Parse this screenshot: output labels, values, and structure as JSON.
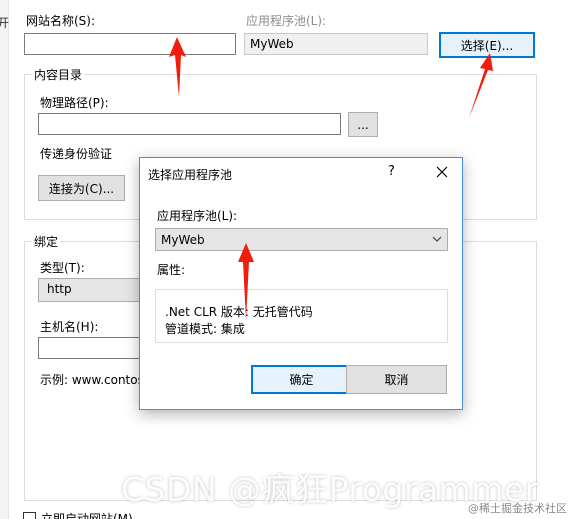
{
  "edge_text": "开",
  "site_name": {
    "label": "网站名称(S):",
    "value": ""
  },
  "app_pool": {
    "label": "应用程序池(L):",
    "value": "MyWeb",
    "select_button": "选择(E)..."
  },
  "content_dir": {
    "group_title": "内容目录",
    "physical_path_label": "物理路径(P):",
    "physical_path_value": "",
    "browse_button": "...",
    "pass_through_label": "传递身份验证",
    "connect_as_button": "连接为(C)..."
  },
  "binding": {
    "group_title": "绑定",
    "type_label": "类型(T):",
    "type_value": "http",
    "host_label": "主机名(H):",
    "host_value": "",
    "example_text": "示例: www.contos"
  },
  "start_checkbox_label": "立即启动网站(M)",
  "dialog": {
    "title": "选择应用程序池",
    "help": "?",
    "pool_label": "应用程序池(L):",
    "pool_value": "MyWeb",
    "props_label": "属性:",
    "props_lines": [
      ".Net CLR 版本: 无托管代码",
      "管道模式: 集成"
    ],
    "ok": "确定",
    "cancel": "取消"
  },
  "watermark": "CSDN @疯狂Programmer",
  "juejin_mark": "@稀土掘金技术社区",
  "colors": {
    "arrow": "#f01e0a",
    "focus": "#0078d7"
  }
}
